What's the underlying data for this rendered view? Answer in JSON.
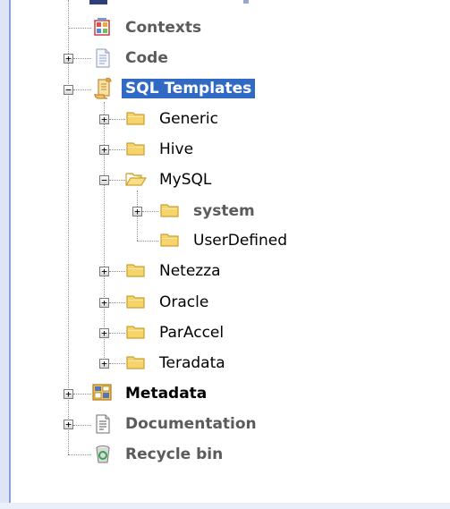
{
  "tree": {
    "contexts": {
      "label": "Contexts",
      "icon": "contexts-icon"
    },
    "code": {
      "label": "Code",
      "expander": "+",
      "icon": "code-icon"
    },
    "sql_templates": {
      "label": "SQL Templates",
      "expander": "−",
      "icon": "sql-templates-icon",
      "selected": true,
      "children": [
        {
          "label": "Generic",
          "expander": "+"
        },
        {
          "label": "Hive",
          "expander": "+"
        },
        {
          "label": "MySQL",
          "expander": "−",
          "children": [
            {
              "label": "system",
              "expander": "+"
            },
            {
              "label": "UserDefined"
            }
          ]
        },
        {
          "label": "Netezza",
          "expander": "+"
        },
        {
          "label": "Oracle",
          "expander": "+"
        },
        {
          "label": "ParAccel",
          "expander": "+"
        },
        {
          "label": "Teradata",
          "expander": "+"
        }
      ]
    },
    "metadata": {
      "label": "Metadata",
      "expander": "+",
      "icon": "metadata-icon"
    },
    "documentation": {
      "label": "Documentation",
      "expander": "+",
      "icon": "documentation-icon"
    },
    "recycle_bin": {
      "label": "Recycle bin",
      "icon": "recycle-bin-icon"
    }
  },
  "colors": {
    "selection": "#316ac5",
    "folder": "#f6d46b",
    "folder_edge": "#c9a130"
  }
}
